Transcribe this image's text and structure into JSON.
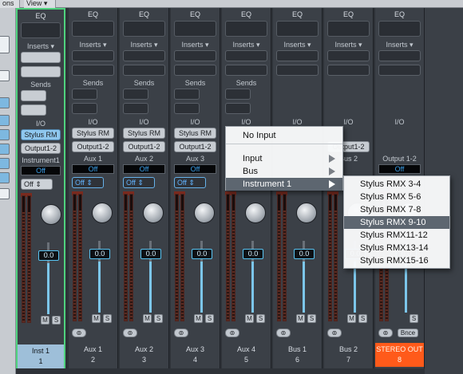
{
  "topbar": {
    "options_label": "ons",
    "options_arrow": "▾",
    "view_label": "View",
    "view_arrow": "▾"
  },
  "labels": {
    "eq": "EQ",
    "inserts": "Inserts ▾",
    "sends": "Sends",
    "io": "I/O",
    "mute": "M",
    "solo": "S",
    "link": "⊚",
    "bounce": "Bnce"
  },
  "channels": [
    {
      "input": "Stylus RM",
      "output": "Output1-2",
      "aux": "Instrument1",
      "auto": "Off",
      "mode": "Off",
      "level": "0.0",
      "name": "Inst 1",
      "num": "1"
    },
    {
      "input": "Stylus RM",
      "output": "Output1-2",
      "aux": "Aux 1",
      "auto": "Off",
      "mode": "Off",
      "level": "0.0",
      "name": "Aux 1",
      "num": "2"
    },
    {
      "input": "Stylus RM",
      "output": "Output1-2",
      "aux": "Aux 2",
      "auto": "Off",
      "mode": "Off",
      "level": "0.0",
      "name": "Aux 2",
      "num": "3"
    },
    {
      "input": "Stylus RM",
      "output": "Output1-2",
      "aux": "Aux 3",
      "auto": "Off",
      "mode": "Off",
      "level": "0.0",
      "name": "Aux 3",
      "num": "4"
    },
    {
      "level": "0.0",
      "name": "Aux 4",
      "num": "5"
    },
    {
      "level": "0.0",
      "name": "Bus 1",
      "num": "6"
    },
    {
      "output": "Output1-2",
      "aux": "Bus 2",
      "level": "0.0",
      "name": "Bus 2",
      "num": "7"
    },
    {
      "aux": "Output 1-2",
      "auto": "Off",
      "level": "0.0",
      "name": "STEREO OUT",
      "num": "8"
    }
  ],
  "input_menu": {
    "items": [
      "No Input",
      "Input",
      "Bus",
      "Instrument 1"
    ],
    "selected": "Instrument 1"
  },
  "submenu": {
    "items": [
      "Stylus RMX 3-4",
      "Stylus RMX 5-6",
      "Stylus RMX 7-8",
      "Stylus RMX 9-10",
      "Stylus RMX11-12",
      "Stylus RMX13-14",
      "Stylus RMX15-16"
    ],
    "selected": "Stylus RMX 9-10"
  },
  "colors": {
    "selected_strip_border": "#4fd37e",
    "stereo_out": "#ff5a1a",
    "level_value": "#58c4f2",
    "menu_highlight": "#5d6670"
  }
}
